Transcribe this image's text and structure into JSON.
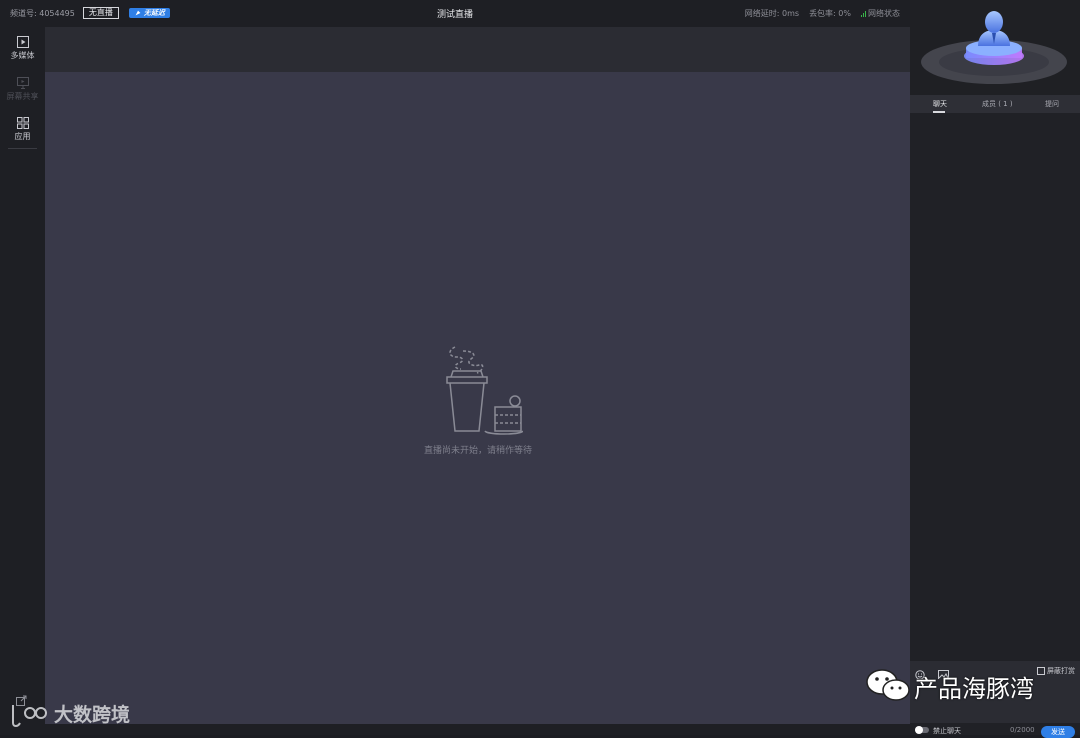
{
  "header": {
    "channel_label": "频道号: 4054495",
    "live_status": "无直播",
    "delay_badge": "无延迟",
    "title": "测试直播",
    "network_delay": "网络延时: 0ms",
    "packet_loss": "丢包率: 0%",
    "network_status": "网络状态"
  },
  "sidebar": {
    "items": [
      {
        "label": "多媒体",
        "icon": "play-square-icon"
      },
      {
        "label": "屏幕共享",
        "icon": "screen-share-icon"
      },
      {
        "label": "应用",
        "icon": "apps-grid-icon"
      }
    ]
  },
  "main": {
    "waiting_text": "直播尚未开始，请稍作等待"
  },
  "right_panel": {
    "tabs": [
      {
        "label": "聊天",
        "active": true
      },
      {
        "label": "成员 ( 1 )",
        "active": false
      },
      {
        "label": "提问",
        "active": false
      }
    ],
    "shield_reward": "屏蔽打赏",
    "mute_chat": "禁止聊天",
    "char_count": "0/2000",
    "send": "发送"
  },
  "watermarks": {
    "bottom_left": "大数跨境",
    "bottom_right": "产品海豚湾"
  },
  "colors": {
    "accent": "#2f7fe6",
    "stage_bg": "#393949",
    "panel_bg": "#202126"
  }
}
